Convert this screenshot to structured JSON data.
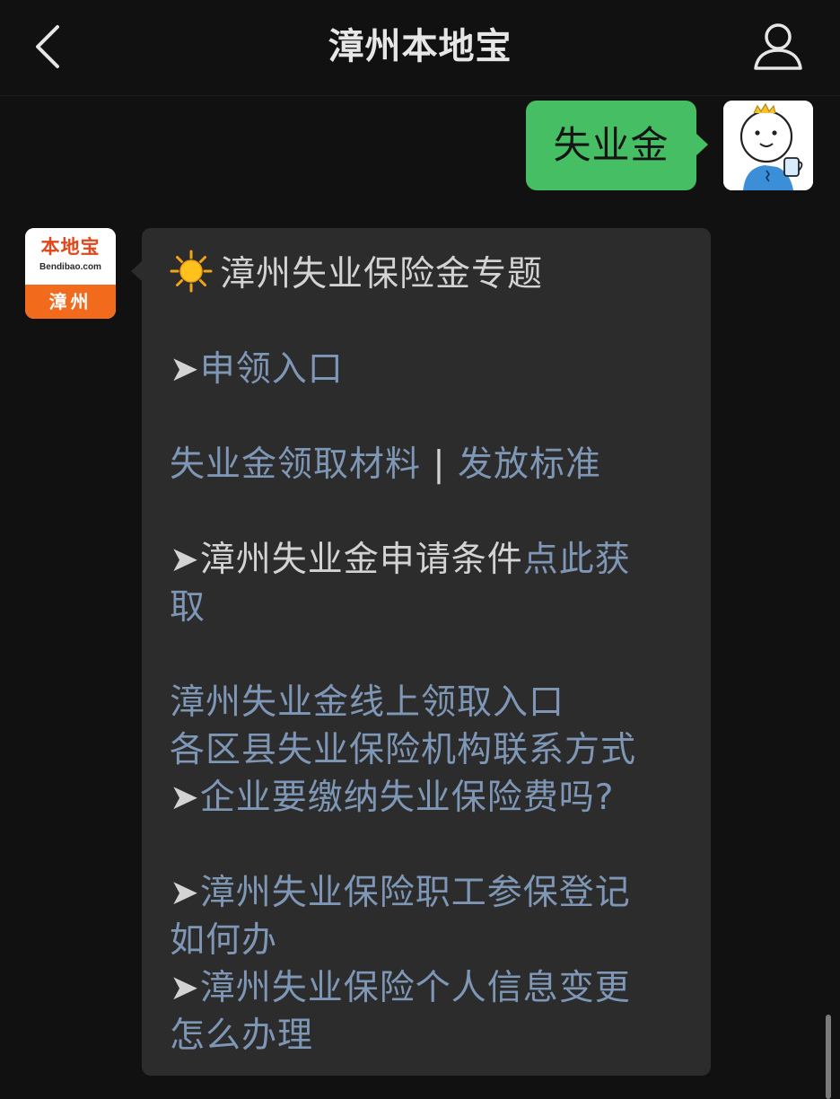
{
  "header": {
    "title": "漳州本地宝"
  },
  "sent_message": {
    "text": "失业金"
  },
  "bot_avatar": {
    "logo_main": "本地宝",
    "logo_sub": "Bendibao.com",
    "city": "漳州"
  },
  "reply": {
    "title": "漳州失业保险金专题",
    "arrow": "➤",
    "apply_entry": "申领入口",
    "materials": "失业金领取材料",
    "separator": " | ",
    "standard": "发放标准",
    "conditions_prefix": "漳州失业金申请条件",
    "conditions_link_1": "点此获",
    "conditions_link_2": "取",
    "online_entry": "漳州失业金线上领取入口",
    "contacts": "各区县失业保险机构联系方式",
    "company_pay": "企业要缴纳失业保险费吗?",
    "register_1": "漳州失业保险职工参保登记",
    "register_2": "如何办",
    "info_change_1": "漳州失业保险个人信息变更",
    "info_change_2": "怎么办理"
  },
  "colors": {
    "background": "#111111",
    "sent_bubble": "#46bf64",
    "received_bubble": "#2c2c2c",
    "link": "#7f97b6",
    "text": "#d3d3d3",
    "brand_orange": "#f26a1b"
  },
  "icons": {
    "back": "chevron-left-icon",
    "profile": "person-icon",
    "title_emoji": "sun-icon"
  }
}
